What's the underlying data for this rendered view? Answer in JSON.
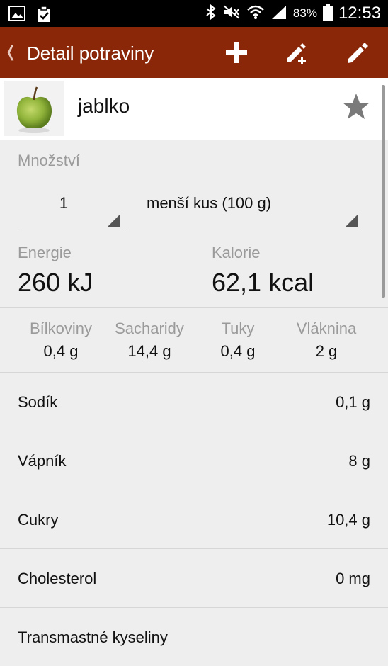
{
  "status_bar": {
    "battery": "83%",
    "time": "12:53"
  },
  "appbar": {
    "title": "Detail potraviny"
  },
  "food": {
    "name": "jablko"
  },
  "quantity": {
    "label": "Množství",
    "value": "1",
    "unit": "menší kus (100 g)"
  },
  "energy": {
    "label": "Energie",
    "value": "260 kJ"
  },
  "calories": {
    "label": "Kalorie",
    "value": "62,1 kcal"
  },
  "macros": [
    {
      "label": "Bílkoviny",
      "value": "0,4 g"
    },
    {
      "label": "Sacharidy",
      "value": "14,4 g"
    },
    {
      "label": "Tuky",
      "value": "0,4 g"
    },
    {
      "label": "Vláknina",
      "value": "2 g"
    }
  ],
  "nutrients": [
    {
      "label": "Sodík",
      "value": "0,1 g"
    },
    {
      "label": "Vápník",
      "value": "8 g"
    },
    {
      "label": "Cukry",
      "value": "10,4 g"
    },
    {
      "label": "Cholesterol",
      "value": "0 mg"
    },
    {
      "label": "Transmastné kyseliny",
      "value": ""
    }
  ],
  "colors": {
    "appbar": "#8a2709",
    "accent_text": "#9a9a9a",
    "background": "#eeeeee"
  }
}
